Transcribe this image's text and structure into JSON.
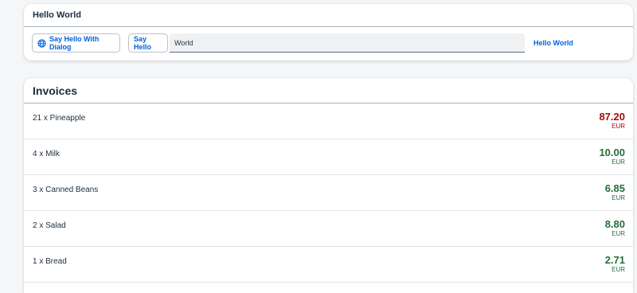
{
  "hello_panel": {
    "title": "Hello World",
    "dialog_button_label": "Say Hello With Dialog",
    "hello_button_label": "Say Hello",
    "input_value": "World",
    "link_text": "Hello World"
  },
  "invoices_panel": {
    "title": "Invoices",
    "items": [
      {
        "name": "21 x Pineapple",
        "value": "87.20",
        "currency": "EUR",
        "color": "#aa0808"
      },
      {
        "name": "4 x Milk",
        "value": "10.00",
        "currency": "EUR",
        "color": "#256f3a"
      },
      {
        "name": "3 x Canned Beans",
        "value": "6.85",
        "currency": "EUR",
        "color": "#256f3a"
      },
      {
        "name": "2 x Salad",
        "value": "8.80",
        "currency": "EUR",
        "color": "#256f3a"
      },
      {
        "name": "1 x Bread",
        "value": "2.71",
        "currency": "EUR",
        "color": "#256f3a"
      }
    ]
  },
  "icons": {
    "dialog_button": "globe-icon"
  },
  "colors": {
    "accent": "#0064d9",
    "negative": "#aa0808",
    "positive": "#256f3a"
  }
}
